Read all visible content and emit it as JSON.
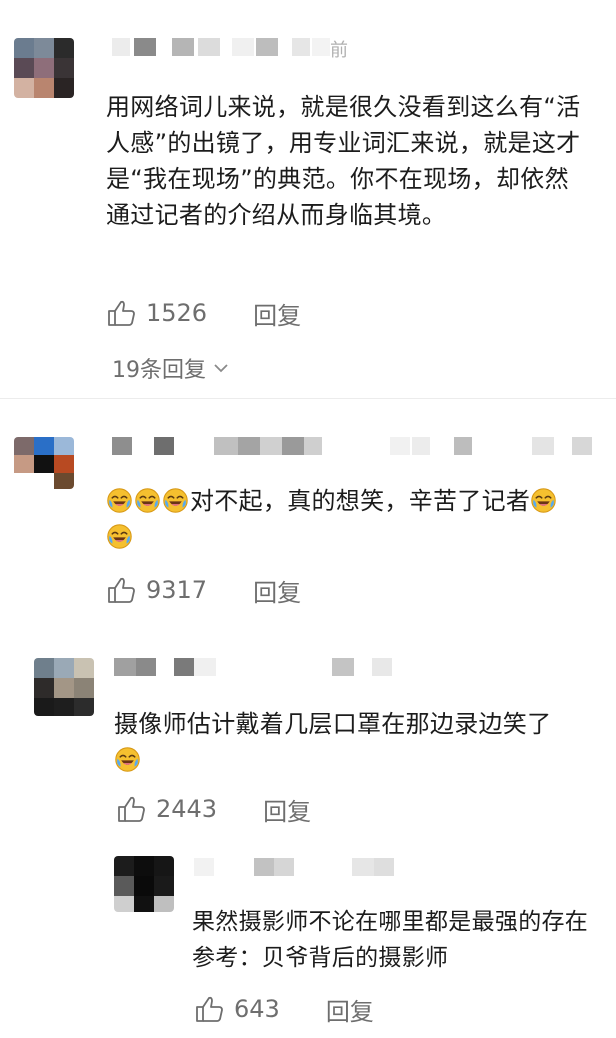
{
  "comments": [
    {
      "text": "用网络词儿来说，就是很久没看到这么有“活人感”的出镜了，用专业词汇来说，就是这才是“我在现场”的典范。你不在现场，却依然通过记者的介绍从而身临其境。",
      "likes": "1526",
      "reply_label": "回复",
      "more_replies": "19条回复",
      "name_tail": "前"
    },
    {
      "text": "对不起，真的想笑，辛苦了记者",
      "likes": "9317",
      "reply_label": "回复"
    },
    {
      "text": "摄像师估计戴着几层口罩在那边录边笑了",
      "likes": "2443",
      "reply_label": "回复"
    },
    {
      "text": "果然摄影师不论在哪里都是最强的存在 参考：贝爷背后的摄影师",
      "likes": "643",
      "reply_label": "回复"
    }
  ],
  "icons": {
    "like": "thumbs-up-icon",
    "chevron": "chevron-down-icon",
    "emoji": "laughing-crying-emoji-icon"
  },
  "colors": {
    "text": "#1c1c1c",
    "meta": "#6e6e6e",
    "emoji_face": "#f6c23e"
  }
}
